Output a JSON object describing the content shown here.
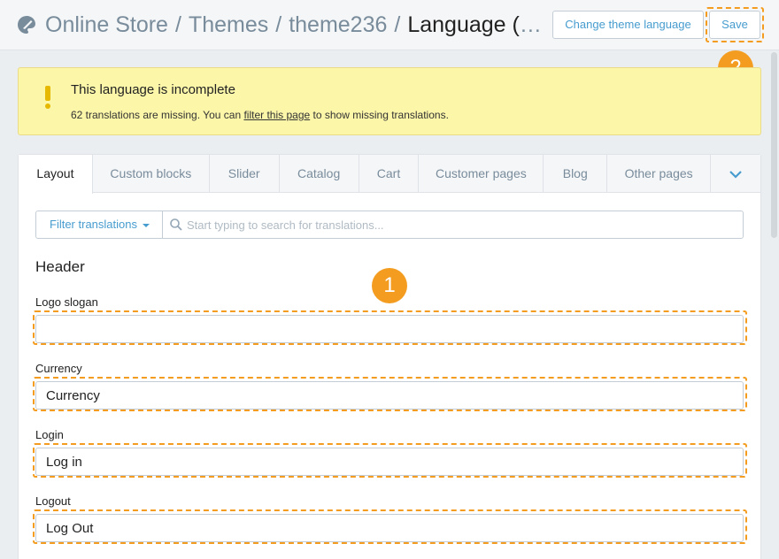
{
  "header": {
    "breadcrumb": [
      "Online Store",
      "Themes",
      "theme236"
    ],
    "separator": "/",
    "current": "Language (En…",
    "change_language_label": "Change theme language",
    "save_label": "Save"
  },
  "callouts": {
    "one": "1",
    "two": "2"
  },
  "alert": {
    "title": "This language is incomplete",
    "msg_prefix": "62 translations are missing. You can ",
    "msg_link": "filter this page",
    "msg_suffix": " to show missing translations."
  },
  "tabs": [
    "Layout",
    "Custom blocks",
    "Slider",
    "Catalog",
    "Cart",
    "Customer pages",
    "Blog",
    "Other pages"
  ],
  "filter": {
    "button_label": "Filter translations",
    "placeholder": "Start typing to search for translations..."
  },
  "section": {
    "title": "Header"
  },
  "fields": [
    {
      "label": "Logo slogan",
      "value": ""
    },
    {
      "label": "Currency",
      "value": "Currency"
    },
    {
      "label": "Login",
      "value": "Log in"
    },
    {
      "label": "Logout",
      "value": "Log Out"
    }
  ],
  "colors": {
    "accent": "#479ccf",
    "callout": "#f39c1f",
    "alert_bg": "#fcf6a9",
    "warning": "#e6b800"
  },
  "icons": {
    "brand": "paint-palette-icon",
    "warning": "exclamation-icon",
    "search": "search-icon",
    "more": "chevron-down-icon"
  }
}
